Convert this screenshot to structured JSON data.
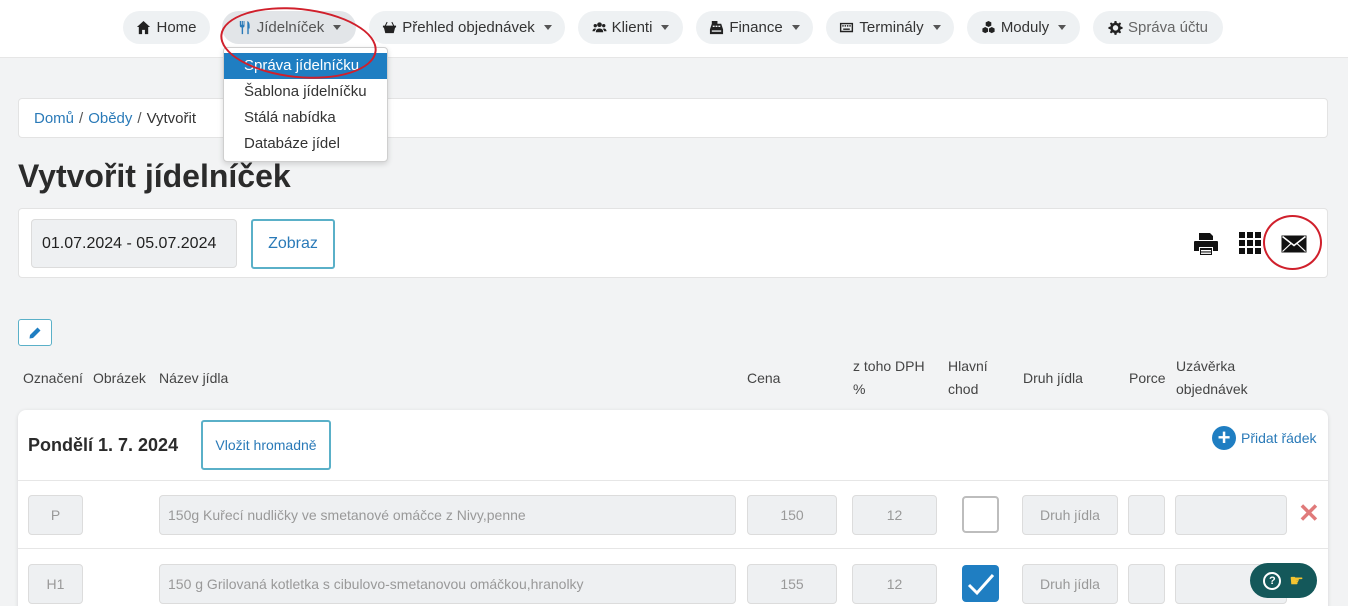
{
  "nav": {
    "items": [
      {
        "label": "Home",
        "icon": "home-icon"
      },
      {
        "label": "Jídelníček",
        "icon": "utensils-icon"
      },
      {
        "label": "Přehled objednávek",
        "icon": "basket-icon"
      },
      {
        "label": "Klienti",
        "icon": "users-icon"
      },
      {
        "label": "Finance",
        "icon": "cash-register-icon"
      },
      {
        "label": "Terminály",
        "icon": "keyboard-icon"
      },
      {
        "label": "Moduly",
        "icon": "cubes-icon"
      },
      {
        "label": "Správa účtu",
        "icon": "gear-icon"
      }
    ],
    "dropdown": [
      "Správa jídelníčku",
      "Šablona jídelníčku",
      "Stálá nabídka",
      "Databáze jídel"
    ]
  },
  "breadcrumb": {
    "home": "Domů",
    "parent": "Obědy",
    "current": "Vytvořit",
    "sep": "/"
  },
  "page": {
    "title": "Vytvořit jídelníček"
  },
  "filter": {
    "date_range": "01.07.2024 - 05.07.2024",
    "show_label": "Zobraz"
  },
  "columns": {
    "label": "Označení",
    "image": "Obrázek",
    "name": "Název jídla",
    "price": "Cena",
    "vat_1": "z toho DPH",
    "vat_2": "%",
    "main_1": "Hlavní",
    "main_2": "chod",
    "type": "Druh jídla",
    "portion": "Porce",
    "closing_1": "Uzávěrka",
    "closing_2": "objednávek"
  },
  "day": {
    "title": "Pondělí 1. 7. 2024",
    "bulk_label": "Vložit hromadně",
    "add_row_label": "Přidat řádek",
    "rows": [
      {
        "code": "P",
        "name": "150g Kuřecí nudličky ve smetanové omáčce z Nivy,penne",
        "price": "150",
        "vat": "12",
        "main": false,
        "type_placeholder": "Druh jídla"
      },
      {
        "code": "H1",
        "name": "150 g Grilovaná kotletka s cibulovo-smetanovou omáčkou,hranolky",
        "price": "155",
        "vat": "12",
        "main": true,
        "type_placeholder": "Druh jídla"
      }
    ]
  },
  "colors": {
    "accent": "#1f7ec2",
    "annotation": "#d0202c",
    "help": "#14585a"
  }
}
